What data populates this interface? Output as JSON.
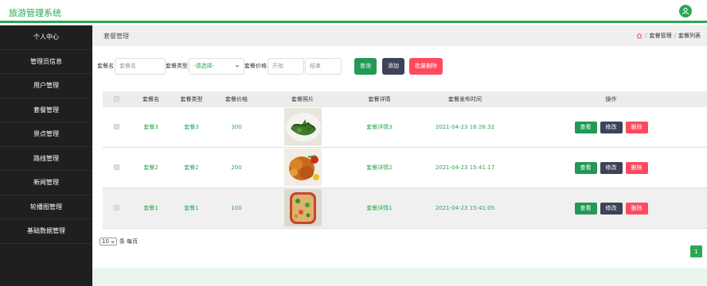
{
  "app": {
    "title": "旅游管理系统"
  },
  "sidebar": {
    "items": [
      {
        "label": "个人中心"
      },
      {
        "label": "管理员信息"
      },
      {
        "label": "用户管理"
      },
      {
        "label": "套餐管理"
      },
      {
        "label": "景点管理"
      },
      {
        "label": "路线管理"
      },
      {
        "label": "新闻管理"
      },
      {
        "label": "轮播图管理"
      },
      {
        "label": "基础数据管理"
      }
    ]
  },
  "header": {
    "title": "套餐管理",
    "breadcrumb": [
      "套餐管理",
      "套餐列表"
    ]
  },
  "search": {
    "name_label": "套餐名",
    "name_placeholder": "套餐名",
    "type_label": "套餐类型",
    "type_selected": "-请选择-",
    "price_label": "套餐价格",
    "price_start_placeholder": "开始",
    "price_end_placeholder": "结束",
    "query_label": "查询",
    "add_label": "添加",
    "batch_delete_label": "批量删除"
  },
  "table": {
    "columns": [
      "套餐名",
      "套餐类型",
      "套餐价格",
      "套餐照片",
      "套餐详情",
      "套餐发布时间",
      "操作"
    ],
    "rows": [
      {
        "name": "套餐3",
        "type": "套餐3",
        "price": "300",
        "detail": "套餐详情3",
        "time": "2021-04-23 16:26:32",
        "photo": "greens"
      },
      {
        "name": "套餐2",
        "type": "套餐2",
        "price": "200",
        "detail": "套餐详情2",
        "time": "2021-04-23 15:41:17",
        "photo": "fried-chicken"
      },
      {
        "name": "套餐1",
        "type": "套餐1",
        "price": "100",
        "detail": "套餐详情1",
        "time": "2021-04-23 15:41:05",
        "photo": "dish"
      }
    ],
    "actions": {
      "view": "查看",
      "edit": "修改",
      "delete": "删除"
    }
  },
  "pagination": {
    "page_size": "10",
    "page_size_suffix": "条 每页",
    "current_page": "1"
  },
  "colors": {
    "accent": "#2aa852",
    "sidebar_bg": "#1f1f1f",
    "dark_button": "#3d4358",
    "danger": "#fe4a5e"
  }
}
